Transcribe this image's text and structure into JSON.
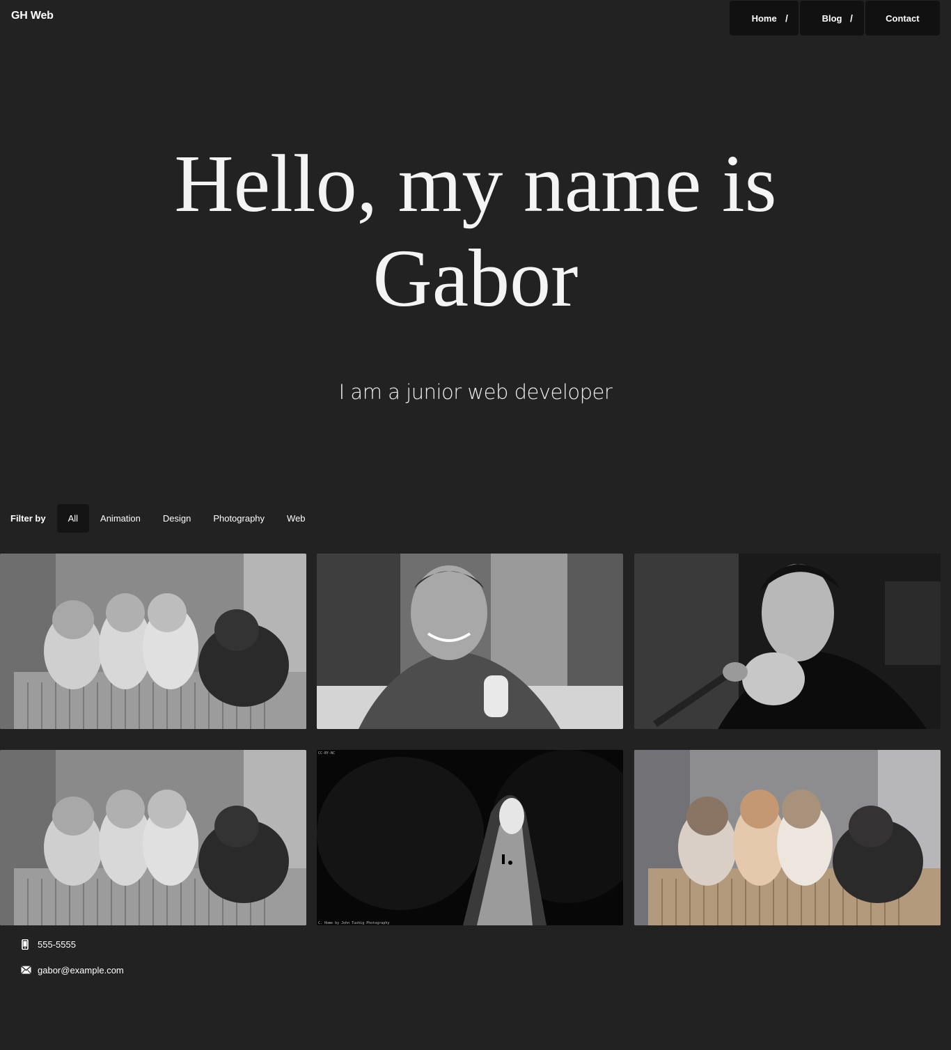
{
  "header": {
    "brand": "GH Web",
    "nav": [
      {
        "label": "Home"
      },
      {
        "label": "Blog"
      },
      {
        "label": "Contact"
      }
    ],
    "separator": "/"
  },
  "hero": {
    "title_line1": "Hello, my name is",
    "title_line2": "Gabor",
    "subtitle": "I am a junior web developer"
  },
  "filter": {
    "label": "Filter by",
    "options": [
      "All",
      "Animation",
      "Design",
      "Photography",
      "Web"
    ],
    "selected": "All"
  },
  "gallery": {
    "items": [
      {
        "subject": "kittens-grayscale"
      },
      {
        "subject": "smiling-man-grayscale"
      },
      {
        "subject": "man-with-microphone-grayscale"
      },
      {
        "subject": "kittens-grayscale"
      },
      {
        "subject": "forest-path-dark"
      },
      {
        "subject": "kittens-color"
      }
    ],
    "forest_caption_top": "CC-BY-NC",
    "forest_caption_bottom": "C. Home by John Tuohig Photography"
  },
  "contact": {
    "phone": "555-5555",
    "email": "gabor@example.com",
    "phone_icon": "mobile-phone-icon",
    "email_icon": "envelope-icon"
  },
  "colors": {
    "background": "#222222",
    "nav_background": "#111111",
    "active_filter": "#141414",
    "text": "#ffffff"
  }
}
